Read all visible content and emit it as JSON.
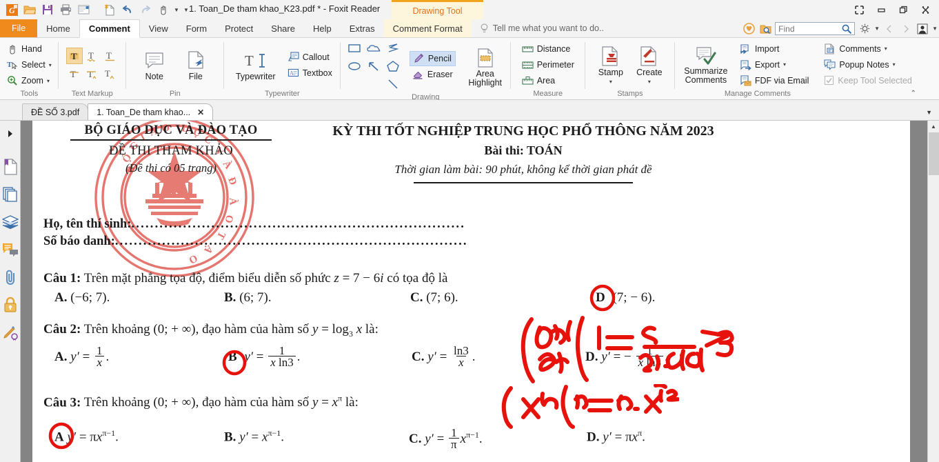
{
  "window": {
    "title": "1. Toan_De tham khao_K23.pdf * - Foxit Reader",
    "contextual_tool": "Drawing Tool",
    "quick_access": [
      {
        "name": "foxit-logo-icon",
        "label": "Foxit"
      },
      {
        "name": "open-icon",
        "label": "Open"
      },
      {
        "name": "save-icon",
        "label": "Save"
      },
      {
        "name": "print-icon",
        "label": "Print"
      },
      {
        "name": "email-icon",
        "label": "Email"
      },
      {
        "name": "new-from-template-icon",
        "label": "Create PDF"
      },
      {
        "name": "undo-icon",
        "label": "Undo"
      },
      {
        "name": "redo-icon",
        "label": "Redo"
      },
      {
        "name": "hand-tool-icon",
        "label": "Hand Tool"
      }
    ],
    "controls": [
      {
        "name": "fullscreen-button",
        "label": "Full Screen"
      },
      {
        "name": "minimize-button",
        "label": "Minimize"
      },
      {
        "name": "restore-button",
        "label": "Restore"
      },
      {
        "name": "close-button",
        "label": "Close"
      }
    ]
  },
  "ribbon_tabs": [
    {
      "label": "File",
      "active": false,
      "kind": "file"
    },
    {
      "label": "Home",
      "active": false
    },
    {
      "label": "Comment",
      "active": true
    },
    {
      "label": "View",
      "active": false
    },
    {
      "label": "Form",
      "active": false
    },
    {
      "label": "Protect",
      "active": false
    },
    {
      "label": "Share",
      "active": false
    },
    {
      "label": "Help",
      "active": false
    },
    {
      "label": "Extras",
      "active": false
    },
    {
      "label": "Comment Format",
      "active": false,
      "kind": "contextual"
    }
  ],
  "tellme": {
    "placeholder": "Tell me what you want to do..",
    "text": "Tell me what you want to do.."
  },
  "find": {
    "placeholder": "Find",
    "value": ""
  },
  "ribbon_groups": [
    {
      "name": "tools",
      "label": "Tools",
      "items": [
        {
          "label": "Hand",
          "icon": "hand-icon",
          "dropdown": false
        },
        {
          "label": "Select",
          "icon": "select-text-icon",
          "dropdown": true
        },
        {
          "label": "Zoom",
          "icon": "zoom-in-icon",
          "dropdown": true
        }
      ]
    },
    {
      "name": "text-markup",
      "label": "Text Markup",
      "items": [
        {
          "label": "Highlight",
          "icon": "highlight-T-icon",
          "selected": true
        },
        {
          "label": "Squiggly",
          "icon": "squiggly-T-icon",
          "selected": false
        },
        {
          "label": "Underline",
          "icon": "underline-T-icon",
          "selected": false
        },
        {
          "label": "Strikeout",
          "icon": "strikeout-T-icon",
          "selected": false
        },
        {
          "label": "Replace Text",
          "icon": "replace-text-icon",
          "selected": false
        },
        {
          "label": "Insert Text",
          "icon": "insert-text-icon",
          "selected": false
        }
      ]
    },
    {
      "name": "pin",
      "label": "Pin",
      "items": [
        {
          "label": "Note",
          "icon": "note-icon"
        },
        {
          "label": "File",
          "icon": "file-attach-icon"
        }
      ]
    },
    {
      "name": "typewriter",
      "label": "Typewriter",
      "items": [
        {
          "label": "Typewriter",
          "icon": "typewriter-icon"
        },
        {
          "label": "Callout",
          "icon": "callout-icon"
        },
        {
          "label": "Textbox",
          "icon": "textbox-icon"
        }
      ]
    },
    {
      "name": "drawing",
      "label": "Drawing",
      "shapes": [
        {
          "label": "Rectangle",
          "icon": "rectangle-icon"
        },
        {
          "label": "Cloud",
          "icon": "cloud-icon"
        },
        {
          "label": "Polygon Line",
          "icon": "polyline-icon"
        },
        {
          "label": "Oval",
          "icon": "oval-icon"
        },
        {
          "label": "Arrow",
          "icon": "arrow-icon"
        },
        {
          "label": "Pentagon",
          "icon": "pentagon-icon"
        },
        {
          "label": "Line",
          "icon": "line-icon"
        }
      ],
      "items": [
        {
          "label": "Pencil",
          "icon": "pencil-icon",
          "selected": true
        },
        {
          "label": "Eraser",
          "icon": "eraser-icon",
          "selected": false
        }
      ],
      "big_items": [
        {
          "label": "Area Highlight",
          "icon": "area-highlight-icon"
        }
      ]
    },
    {
      "name": "measure",
      "label": "Measure",
      "items": [
        {
          "label": "Distance",
          "icon": "distance-icon"
        },
        {
          "label": "Perimeter",
          "icon": "perimeter-icon"
        },
        {
          "label": "Area",
          "icon": "area-measure-icon"
        }
      ]
    },
    {
      "name": "stamps",
      "label": "Stamps",
      "big_items": [
        {
          "label": "Stamp",
          "icon": "stamp-icon",
          "dropdown": true
        },
        {
          "label": "Create",
          "icon": "create-stamp-icon",
          "dropdown": true
        }
      ]
    },
    {
      "name": "manage-comments",
      "label": "Manage Comments",
      "big_items": [
        {
          "label": "Summarize Comments",
          "icon": "summarize-comments-icon"
        }
      ],
      "items": [
        {
          "label": "Import",
          "icon": "import-icon",
          "dropdown": false,
          "disabled": false
        },
        {
          "label": "Export",
          "icon": "export-icon",
          "dropdown": true,
          "disabled": false
        },
        {
          "label": "FDF via Email",
          "icon": "fdf-email-icon",
          "dropdown": false,
          "disabled": false
        },
        {
          "label": "Comments",
          "icon": "comments-icon",
          "dropdown": true,
          "disabled": false
        },
        {
          "label": "Popup Notes",
          "icon": "popup-notes-icon",
          "dropdown": true,
          "disabled": false
        },
        {
          "label": "Keep Tool Selected",
          "icon": "checkbox-icon",
          "dropdown": false,
          "disabled": true
        }
      ]
    }
  ],
  "doc_tabs": [
    {
      "label": "ĐỀ SỐ 3.pdf",
      "active": false,
      "closable": false
    },
    {
      "label": "1. Toan_De tham khao...",
      "active": true,
      "closable": true
    }
  ],
  "left_panel_icons": [
    {
      "name": "panel-toggle-icon",
      "label": "Show/Hide Panel"
    },
    {
      "name": "bookmarks-icon",
      "label": "Bookmarks"
    },
    {
      "name": "pages-thumbnail-icon",
      "label": "Page Thumbnails"
    },
    {
      "name": "layers-icon",
      "label": "Layers"
    },
    {
      "name": "comments-panel-icon",
      "label": "Comments"
    },
    {
      "name": "attachments-icon",
      "label": "Attachments"
    },
    {
      "name": "security-icon",
      "label": "Security"
    },
    {
      "name": "signatures-icon",
      "label": "Digital Signatures"
    }
  ],
  "document": {
    "header_left": {
      "line1": "BỘ GIÁO DỤC VÀ ĐÀO TẠO",
      "line2": "ĐỀ THI THAM KHẢO",
      "line3": "(Đề thi có 05 trang)"
    },
    "header_right": {
      "line1": "KỲ THI TỐT NGHIỆP TRUNG HỌC PHỔ THÔNG NĂM 2023",
      "line2": "Bài thi: TOÁN",
      "line3": "Thời gian làm bài: 90 phút, không kể thời gian phát đề"
    },
    "seal_text": "BỘ GIÁO DỤC VÀ ĐÀO TẠO",
    "fields": [
      {
        "label": "Họ, tên thí sinh:",
        "dots": "......................................................................."
      },
      {
        "label": "Số báo danh:",
        "dots": "..........................................................................."
      }
    ],
    "questions": [
      {
        "number": "Câu 1:",
        "prompt_parts": [
          "Trên mặt phẳng tọa độ, điểm biểu diễn số phức ",
          "z",
          " = 7 − 6",
          "i",
          " có tọa độ là"
        ],
        "prompt_plain": "Trên mặt phẳng tọa độ, điểm biểu diễn số phức z = 7 − 6i có tọa độ là",
        "options": [
          {
            "key": "A.",
            "text": "(−6; 7)."
          },
          {
            "key": "B.",
            "text": "(6; 7)."
          },
          {
            "key": "C.",
            "text": "(7; 6)."
          },
          {
            "key": "D",
            "text": "(7; − 6).",
            "circled": true
          }
        ]
      },
      {
        "number": "Câu 2:",
        "prompt_plain": "Trên khoảng (0; + ∞), đạo hàm của hàm số y = log₃ x là:",
        "options": [
          {
            "key": "A.",
            "text": "y′ = 1/x."
          },
          {
            "key": "B",
            "text": "y′ = 1/(x ln3).",
            "circled": true
          },
          {
            "key": "C.",
            "text": "y′ = ln3/x."
          },
          {
            "key": "D.",
            "text": "y′ = − 1/(x ln3)."
          }
        ]
      },
      {
        "number": "Câu 3:",
        "prompt_plain": "Trên khoảng (0; + ∞), đạo hàm của hàm số y = xπ là:",
        "options": [
          {
            "key": "A",
            "text": "y′ = πx^(π−1).",
            "circled": true
          },
          {
            "key": "B.",
            "text": "y′ = x^(π−1)."
          },
          {
            "key": "C.",
            "text": "y′ = (1/π) x^(π−1)."
          },
          {
            "key": "D.",
            "text": "y′ = πx^π."
          }
        ]
      }
    ],
    "annotations": [
      {
        "name": "ink-note-q2",
        "text": "(log a x)′ = 1 / (x · lna)  → B",
        "color": "#e8120c"
      },
      {
        "name": "ink-note-q3",
        "text": "(x^n)′ = n·x^(n−1)",
        "color": "#e8120c"
      },
      {
        "name": "ink-circle-q1-d",
        "text": "D",
        "color": "#e8120c"
      },
      {
        "name": "ink-circle-q2-b",
        "text": "B",
        "color": "#e8120c"
      },
      {
        "name": "ink-circle-q3-a",
        "text": "A",
        "color": "#e8120c"
      }
    ]
  },
  "colors": {
    "accent_orange": "#f08a1c",
    "contextual_yellow": "#fdf6dd",
    "ink_red": "#e8120c",
    "seal_red": "#e0564e",
    "selected_blue": "#cfe0f5",
    "selected_tan": "#f5d9a0"
  }
}
